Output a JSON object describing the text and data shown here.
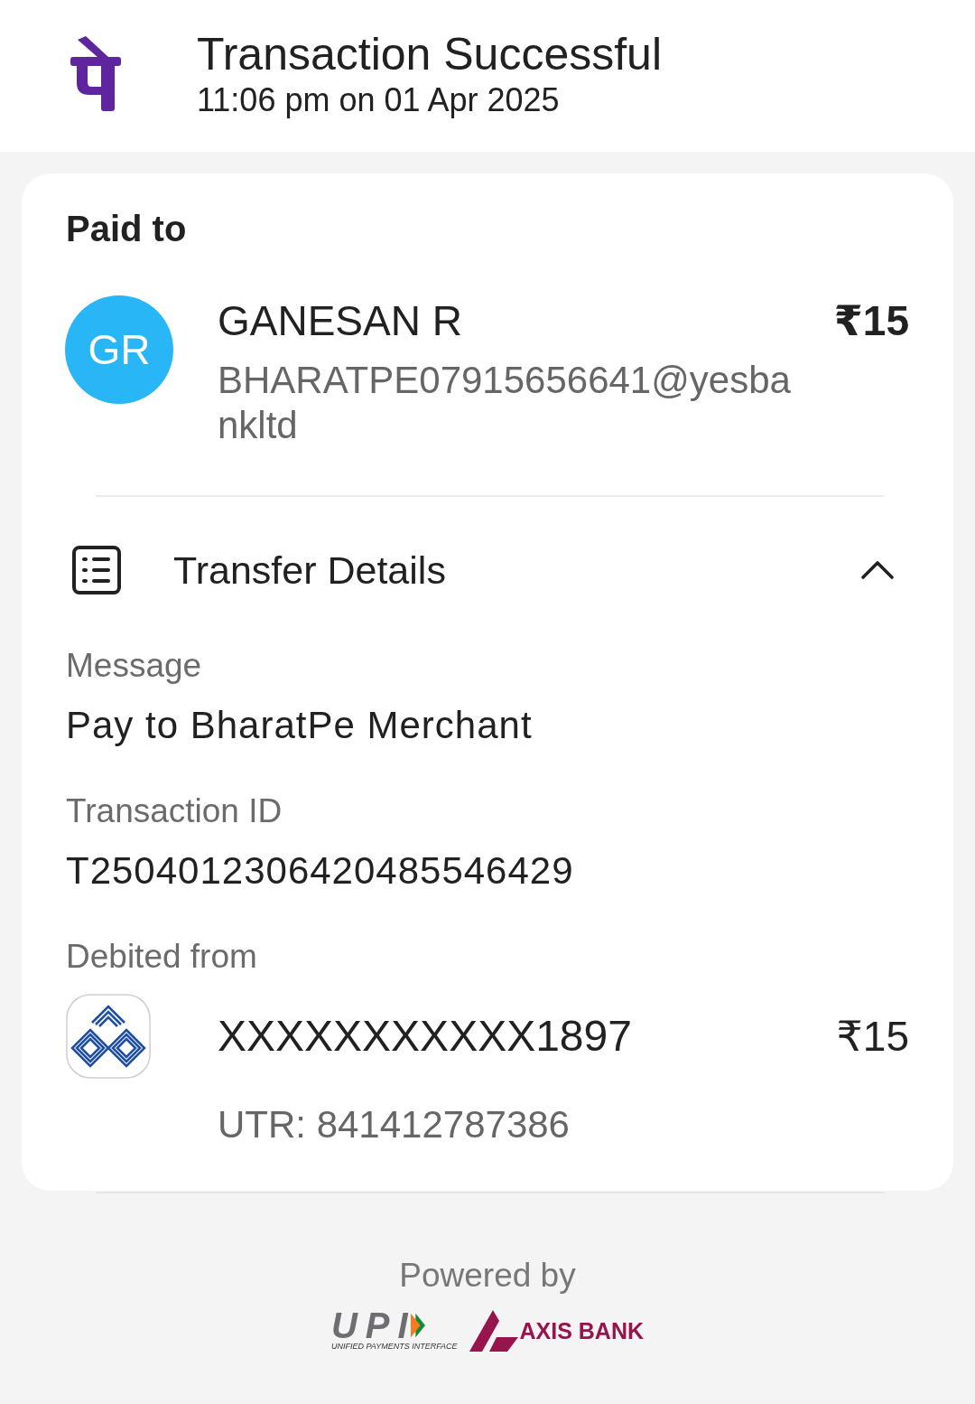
{
  "header": {
    "title": "Transaction Successful",
    "timestamp": "11:06 pm on 01 Apr 2025"
  },
  "paid_to": {
    "heading": "Paid to",
    "initials": "GR",
    "name": "GANESAN R",
    "upi_id": "BHARATPE07915656641@yesbankltd",
    "amount": "₹15"
  },
  "transfer_details": {
    "title": "Transfer Details",
    "expanded": true,
    "fields": [
      {
        "label": "Message",
        "value": "Pay to BharatPe Merchant"
      },
      {
        "label": "Transaction ID",
        "value": "T2504012306420485546429"
      }
    ],
    "debited_from": {
      "label": "Debited from",
      "account": "XXXXXXXXXXX1897",
      "amount": "₹15",
      "utr": "UTR: 841412787386"
    }
  },
  "footer": {
    "powered_by": "Powered by",
    "upi_logo": {
      "wordmark": "UPI",
      "tagline": "UNIFIED PAYMENTS INTERFACE"
    },
    "bank_logo": {
      "wordmark": "AXIS BANK"
    }
  }
}
